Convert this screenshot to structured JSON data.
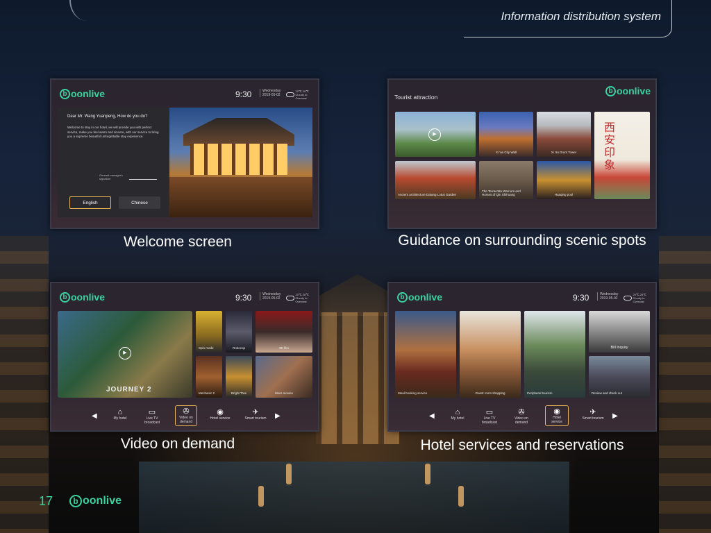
{
  "header": {
    "title": "Information distribution system"
  },
  "brand": {
    "logo_text": "oonlive",
    "logo_letter": "b",
    "accent_color": "#39d3a0"
  },
  "status": {
    "time": "9:30",
    "day": "Wednesday",
    "date": "2019-05-02",
    "weather_temp": "20℃-28℃",
    "weather_desc": "Cloudy to Overcast"
  },
  "welcome_panel": {
    "greeting": "Dear Mr. Wang Yuanpeng, How do you do?",
    "body": "Welcome to stay in our hotel, we will provide you with perfect service, make you feel warm and sincere, with our service to bring you a supreme beautiful unforgettable stay experience.",
    "signature_label": "General manager's signature",
    "lang_english": "English",
    "lang_chinese": "Chinese",
    "caption": "Welcome screen"
  },
  "tourist_panel": {
    "heading": "Tourist attraction",
    "tiles": [
      {
        "label": ""
      },
      {
        "label": "Xi 'an City Wall"
      },
      {
        "label": "Xi 'an Drum Tower"
      },
      {
        "label": "西安印象"
      },
      {
        "label": "Ancient architecture Datang Lotus Garden"
      },
      {
        "label": "The Terracotta Warriors and Horses of Qin Shihuang"
      },
      {
        "label": "Huaqing pool"
      }
    ],
    "caption": "Guidance on surrounding scenic spots"
  },
  "video_panel": {
    "hero_title": "JOURNEY 2",
    "tiles": [
      {
        "label": "Spin mode"
      },
      {
        "label": "Robocop"
      },
      {
        "label": "3D film"
      },
      {
        "label": "Mechanic 2"
      },
      {
        "label": "Bright Tree"
      },
      {
        "label": "More movies"
      }
    ],
    "nav": [
      {
        "label": "My hotel"
      },
      {
        "label": "Live TV broadcast"
      },
      {
        "label": "Video on demand"
      },
      {
        "label": "Hotel service"
      },
      {
        "label": "Smart tourism"
      }
    ],
    "caption": "Video on demand"
  },
  "services_panel": {
    "tiles": [
      {
        "label": "Meal booking service"
      },
      {
        "label": "Guest room shopping"
      },
      {
        "label": "Peripheral tourism"
      },
      {
        "label": "Bill inquiry"
      },
      {
        "label": "Review and check out"
      }
    ],
    "nav": [
      {
        "label": "My hotel"
      },
      {
        "label": "Live TV broadcast"
      },
      {
        "label": "Video on demand"
      },
      {
        "label": "Hotel service"
      },
      {
        "label": "Smart tourism"
      }
    ],
    "caption": "Hotel services and reservations"
  },
  "footer": {
    "page_number": "17",
    "logo_text": "oonlive",
    "logo_letter": "b"
  }
}
